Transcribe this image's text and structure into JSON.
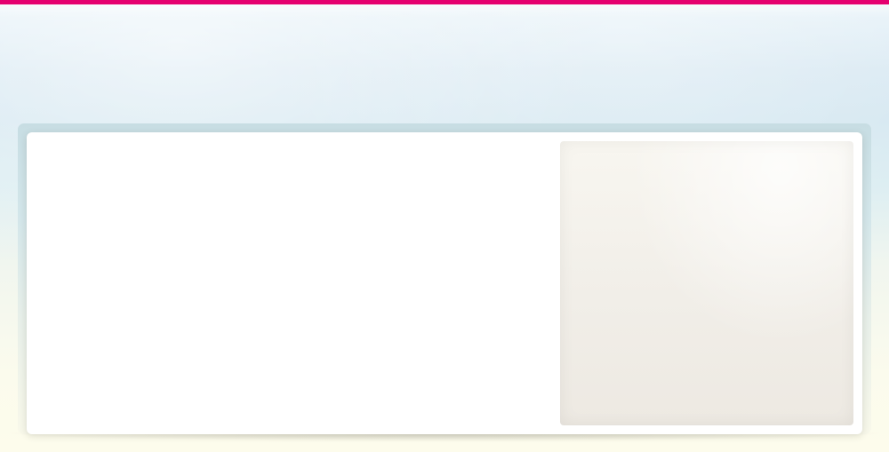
{
  "page": {
    "background_style": "soft-blue-to-cream",
    "accent_color": "#e5006f"
  },
  "layout": {
    "header_accent": "top-accent-bar",
    "main_panel": "blank-content-panel",
    "side_panel": "blank-sidebar-panel"
  }
}
